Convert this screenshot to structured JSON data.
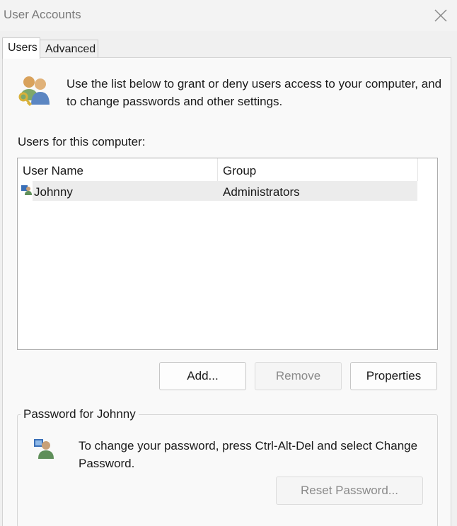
{
  "window": {
    "title": "User Accounts"
  },
  "tabs": [
    {
      "label": "Users",
      "active": true
    },
    {
      "label": "Advanced",
      "active": false
    }
  ],
  "intro": {
    "text": "Use the list below to grant or deny users access to your computer, and to change passwords and other settings."
  },
  "users_list": {
    "label": "Users for this computer:",
    "columns": [
      "User Name",
      "Group"
    ],
    "rows": [
      {
        "name": "Johnny",
        "group": "Administrators"
      }
    ]
  },
  "buttons": {
    "add": "Add...",
    "remove": "Remove",
    "properties": "Properties"
  },
  "password_group": {
    "label": "Password for Johnny",
    "text": "To change your password, press Ctrl-Alt-Del and select Change Password.",
    "reset_button": "Reset Password..."
  },
  "icons": {
    "users": "users-key-icon",
    "row_user": "user-icon",
    "password": "user-password-icon",
    "close": "close-icon"
  }
}
